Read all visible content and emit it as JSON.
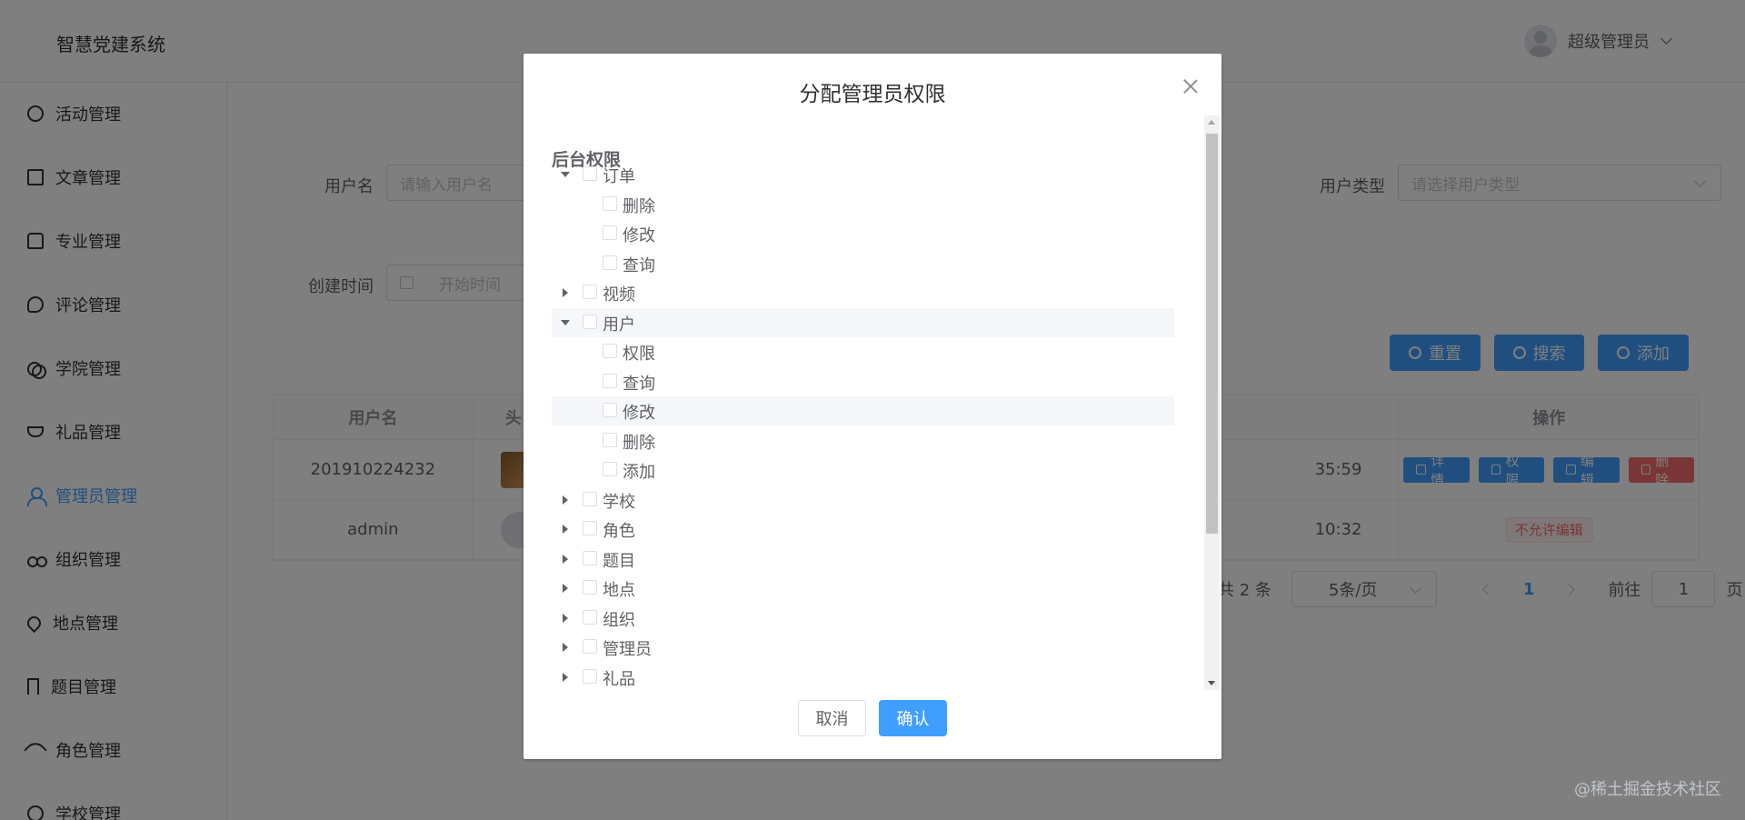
{
  "header": {
    "brand": "智慧党建系统",
    "user_name": "超级管理员"
  },
  "sidebar": {
    "items": [
      {
        "label": "活动管理",
        "icon": "basketball-icon"
      },
      {
        "label": "文章管理",
        "icon": "notebook-icon"
      },
      {
        "label": "专业管理",
        "icon": "suitcase-icon"
      },
      {
        "label": "评论管理",
        "icon": "chat-icon"
      },
      {
        "label": "学院管理",
        "icon": "link-icon"
      },
      {
        "label": "礼品管理",
        "icon": "trophy-icon"
      },
      {
        "label": "管理员管理",
        "icon": "user-icon",
        "active": true
      },
      {
        "label": "组织管理",
        "icon": "bicycle-icon"
      },
      {
        "label": "地点管理",
        "icon": "location-icon"
      },
      {
        "label": "题目管理",
        "icon": "bookmark-icon"
      },
      {
        "label": "角色管理",
        "icon": "feather-icon"
      },
      {
        "label": "学校管理",
        "icon": "school-icon"
      }
    ]
  },
  "filters": {
    "username_label": "用户名",
    "username_placeholder": "请输入用户名",
    "usertype_label": "用户类型",
    "usertype_placeholder": "请选择用户类型",
    "created_label": "创建时间",
    "start_placeholder": "开始时间"
  },
  "actions": {
    "reset": "重置",
    "search": "搜索",
    "add": "添加"
  },
  "table": {
    "columns": [
      "用户名",
      "头",
      "操作"
    ],
    "rows": [
      {
        "username": "201910224232",
        "time_tail": "35:59",
        "ops": [
          "详情",
          "权限",
          "编辑",
          "删除"
        ]
      },
      {
        "username": "admin",
        "time_tail": "10:32",
        "tag": "不允许编辑"
      }
    ]
  },
  "pagination": {
    "total_text": "共 2 条",
    "page_size": "5条/页",
    "current_page": "1",
    "goto_label": "前往",
    "goto_value": "1",
    "page_suffix": "页"
  },
  "watermark": "@稀土掘金技术社区",
  "dialog": {
    "title": "分配管理员权限",
    "tree_title": "后台权限",
    "nodes": [
      {
        "label": "订单",
        "level": 0,
        "state": "expanded",
        "highlight": false
      },
      {
        "label": "删除",
        "level": 1,
        "state": "leaf",
        "highlight": false
      },
      {
        "label": "修改",
        "level": 1,
        "state": "leaf",
        "highlight": false
      },
      {
        "label": "查询",
        "level": 1,
        "state": "leaf",
        "highlight": false
      },
      {
        "label": "视频",
        "level": 0,
        "state": "collapsed",
        "highlight": false
      },
      {
        "label": "用户",
        "level": 0,
        "state": "expanded",
        "highlight": true
      },
      {
        "label": "权限",
        "level": 1,
        "state": "leaf",
        "highlight": false
      },
      {
        "label": "查询",
        "level": 1,
        "state": "leaf",
        "highlight": false
      },
      {
        "label": "修改",
        "level": 1,
        "state": "leaf",
        "highlight": true
      },
      {
        "label": "删除",
        "level": 1,
        "state": "leaf",
        "highlight": false
      },
      {
        "label": "添加",
        "level": 1,
        "state": "leaf",
        "highlight": false
      },
      {
        "label": "学校",
        "level": 0,
        "state": "collapsed",
        "highlight": false
      },
      {
        "label": "角色",
        "level": 0,
        "state": "collapsed",
        "highlight": false
      },
      {
        "label": "题目",
        "level": 0,
        "state": "collapsed",
        "highlight": false
      },
      {
        "label": "地点",
        "level": 0,
        "state": "collapsed",
        "highlight": false
      },
      {
        "label": "组织",
        "level": 0,
        "state": "collapsed",
        "highlight": false
      },
      {
        "label": "管理员",
        "level": 0,
        "state": "collapsed",
        "highlight": false
      },
      {
        "label": "礼品",
        "level": 0,
        "state": "collapsed",
        "highlight": false
      }
    ],
    "cancel": "取消",
    "confirm": "确认"
  },
  "colors": {
    "primary": "#409eff",
    "danger": "#f56c6c",
    "mask": "rgba(0,0,0,0.5)"
  }
}
